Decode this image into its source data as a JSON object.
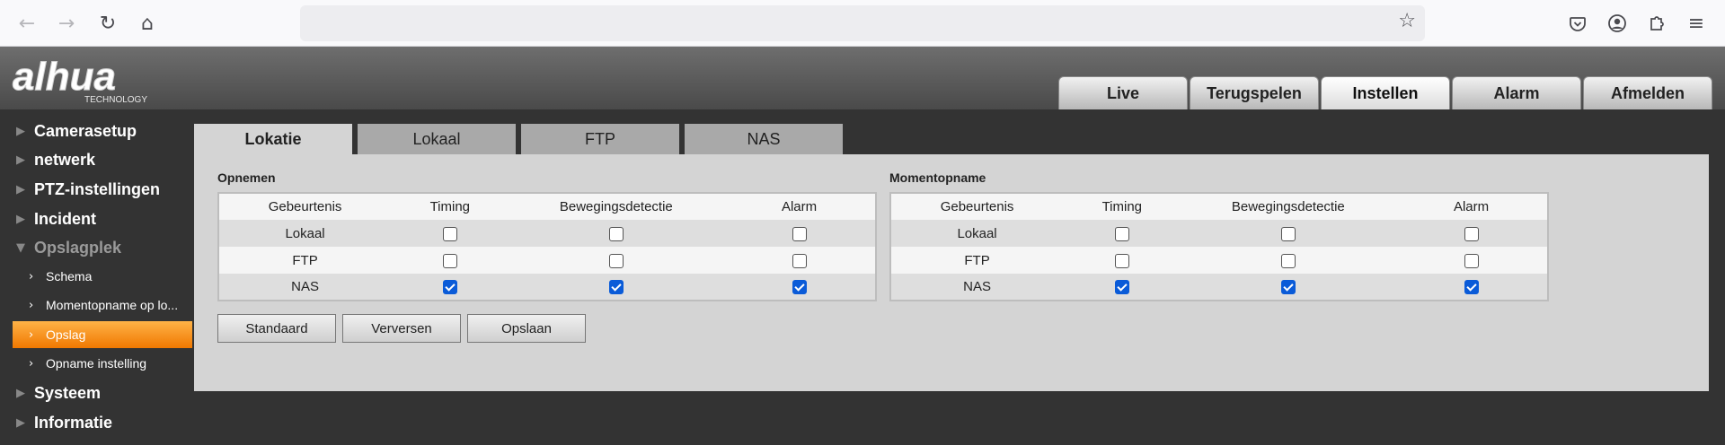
{
  "browser": {
    "url": "",
    "icons": {
      "back": "arrow-left-icon",
      "forward": "arrow-right-icon",
      "reload": "reload-icon",
      "home": "home-icon",
      "bookmark": "star-icon",
      "pocket": "pocket-icon",
      "account": "account-icon",
      "extensions": "puzzle-icon",
      "menu": "hamburger-icon"
    }
  },
  "header": {
    "logo_text": "alhua",
    "logo_subtext": "TECHNOLOGY",
    "tabs": [
      {
        "label": "Live",
        "active": false
      },
      {
        "label": "Terugspelen",
        "active": false
      },
      {
        "label": "Instellen",
        "active": true
      },
      {
        "label": "Alarm",
        "active": false
      },
      {
        "label": "Afmelden",
        "active": false
      }
    ]
  },
  "sidebar": {
    "items": [
      {
        "label": "Camerasetup"
      },
      {
        "label": "netwerk"
      },
      {
        "label": "PTZ-instellingen"
      },
      {
        "label": "Incident"
      },
      {
        "label": "Opslagplek",
        "open": true
      },
      {
        "label": "Systeem"
      },
      {
        "label": "Informatie"
      }
    ],
    "subitems": [
      {
        "label": "Schema",
        "active": false
      },
      {
        "label": "Momentopname op lo...",
        "active": false
      },
      {
        "label": "Opslag",
        "active": true
      },
      {
        "label": "Opname instelling",
        "active": false
      }
    ]
  },
  "subtabs": [
    {
      "label": "Lokaal",
      "active": false
    },
    {
      "label": "FTP",
      "active": false
    },
    {
      "label": "NAS",
      "active": false
    }
  ],
  "subtabs_first": {
    "label": "Lokatie",
    "active": true
  },
  "opnemen": {
    "title": "Opnemen",
    "columns": [
      "Gebeurtenis",
      "Timing",
      "Bewegingsdetectie",
      "Alarm"
    ],
    "rows": [
      {
        "label": "Lokaal",
        "timing": false,
        "motion": false,
        "alarm": false
      },
      {
        "label": "FTP",
        "timing": false,
        "motion": false,
        "alarm": false
      },
      {
        "label": "NAS",
        "timing": true,
        "motion": true,
        "alarm": true
      }
    ]
  },
  "momentopname": {
    "title": "Momentopname",
    "columns": [
      "Gebeurtenis",
      "Timing",
      "Bewegingsdetectie",
      "Alarm"
    ],
    "rows": [
      {
        "label": "Lokaal",
        "timing": false,
        "motion": false,
        "alarm": false
      },
      {
        "label": "FTP",
        "timing": false,
        "motion": false,
        "alarm": false
      },
      {
        "label": "NAS",
        "timing": true,
        "motion": true,
        "alarm": true
      }
    ]
  },
  "buttons": {
    "default_label": "Standaard",
    "refresh_label": "Verversen",
    "save_label": "Opslaan"
  },
  "colors": {
    "accent": "#f07800",
    "checkbox": "#0a5bd8",
    "panel": "#d4d4d4"
  }
}
